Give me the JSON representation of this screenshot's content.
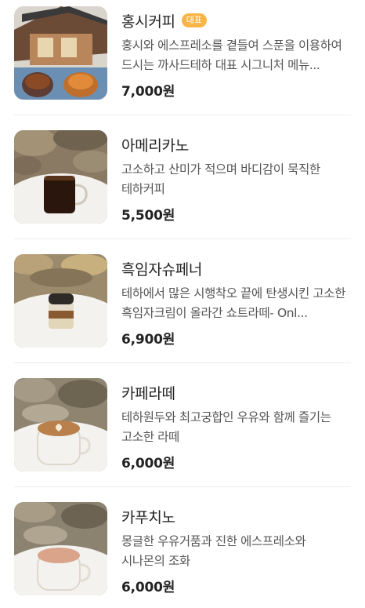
{
  "menu": {
    "items": [
      {
        "name": "홍시커피",
        "badge": "대표",
        "description": "홍시와 에스프레소를 곁들여 스푼을 이용하여 드시는 까사드테하 대표 시그니처 메뉴...",
        "price": "7,000원",
        "image": "hongsi-coffee-photo"
      },
      {
        "name": "아메리카노",
        "badge": "",
        "description": "고소하고 산미가 적으며 바디감이 묵직한 테하커피",
        "price": "5,500원",
        "image": "americano-photo"
      },
      {
        "name": "흑임자슈페너",
        "badge": "",
        "description": "테하에서 많은 시행착오 끝에 탄생시킨 고소한 흑임자크림이 올라간 쇼트라떼- Onl...",
        "price": "6,900원",
        "image": "black-sesame-einspanner-photo"
      },
      {
        "name": "카페라떼",
        "badge": "",
        "description": "테하원두와 최고궁합인 우유와 함께 즐기는 고소한 라떼",
        "price": "6,000원",
        "image": "cafe-latte-photo"
      },
      {
        "name": "카푸치노",
        "badge": "",
        "description": "몽글한 우유거품과 진한 에스프레소와 시나몬의 조화",
        "price": "6,000원",
        "image": "cappuccino-photo"
      }
    ]
  },
  "colors": {
    "badge": "#f7b547",
    "price": "#222222",
    "description": "#555555"
  }
}
